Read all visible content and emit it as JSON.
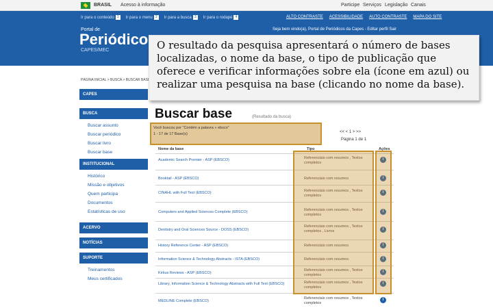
{
  "gov_bar": {
    "brasil": "BRASIL",
    "acesso": "Acesso à informação",
    "links": [
      "Participe",
      "Serviços",
      "Legislação",
      "Canais"
    ]
  },
  "header": {
    "access_links": [
      {
        "label": "Ir para o conteúdo",
        "num": "1"
      },
      {
        "label": "Ir para o menu",
        "num": "2"
      },
      {
        "label": "Ir para a busca",
        "num": "3"
      },
      {
        "label": "Ir para o rodapé",
        "num": "4"
      }
    ],
    "right_links": [
      "ALTO CONTRASTE",
      "ACESSIBILIDADE",
      "AUTO CONTRASTE",
      "MAPA DO SITE"
    ],
    "portal_de": "Portal de",
    "title": "Periódicos",
    "subtitle": "CAPES/MEC",
    "welcome": "Seja bem vindo(a), Portal de Periódicos da Capes - Editar perfil   Sair"
  },
  "breadcrumb": "PÁGINA INICIAL > BUSCA > BUSCAR BASE",
  "sidebar": {
    "capes": "CAPES",
    "busca": "BUSCA",
    "busca_items": [
      "Buscar assunto",
      "Buscar periódico",
      "Buscar livro",
      "Buscar base"
    ],
    "institucional": "INSTITUCIONAL",
    "inst_items": [
      "Histórico",
      "Missão e objetivos",
      "Quem participa",
      "Documentos",
      "Estatísticas de uso"
    ],
    "acervo": "ACERVO",
    "noticias": "NOTÍCIAS",
    "suporte": "SUPORTE",
    "suporte_items": [
      "Treinamentos",
      "Meus certificados"
    ]
  },
  "callout": "O resultado da pesquisa apresentará o número de bases localizadas, o nome da base, o tipo de publicação que oferece e verificar informações sobre ela (ícone em azul) ou realizar uma pesquisa na base (clicando no nome da base).",
  "main": {
    "title": "Buscar base",
    "subtitle": "(Resultado da busca)",
    "summary_line1": "Você buscou por \"Contém a palavra » ebsco\"",
    "summary_line2": "1 - 17 de 17 Base(s)",
    "pager_nav": "<<       <        1        >       >>",
    "pager_text": "Página  1 de 1",
    "col_nome": "Nome da base",
    "col_tipo": "Tipo",
    "col_acoes": "Ações",
    "info_glyph": "i",
    "rows": [
      {
        "name": "Academic Search Premier - ASP (EBSCO)",
        "tipo": "Referenciais com resumos , Textos completos"
      },
      {
        "name": "Booktail - ASP (EBSCO)",
        "tipo": "Referenciais com resumos"
      },
      {
        "name": "CINAHL with Full Text (EBSCO)",
        "tipo": "Referenciais com resumos , Textos completos"
      },
      {
        "name": "Computers and Applied Sciences Complete (EBSCO)",
        "tipo": "Referenciais com resumos , Textos completos"
      },
      {
        "name": "Dentistry and Oral Sciences Source - DOSS (EBSCO)",
        "tipo": "Referenciais com resumos , Textos completos , Livros"
      },
      {
        "name": "History Reference Center - ASP (EBSCO)",
        "tipo": "Referenciais com resumos"
      },
      {
        "name": "Information Science & Technology Abstracts - ISTA (EBSCO)",
        "tipo": "Referenciais com resumos"
      },
      {
        "name": "Kirkus Reviews - ASP (EBSCO)",
        "tipo": "Referenciais com resumos , Textos completos"
      },
      {
        "name": "Library, Information Science & Technology Abstracts with Full Text (EBSCO)",
        "tipo": "Referenciais com resumos , Textos completos"
      },
      {
        "name": "MEDLINE Complete (EBSCO)",
        "tipo": "Referenciais com resumos , Textos completos"
      }
    ]
  },
  "colors": {
    "header_blue": "#1f5fa8",
    "highlight_orange": "#c8902c"
  }
}
